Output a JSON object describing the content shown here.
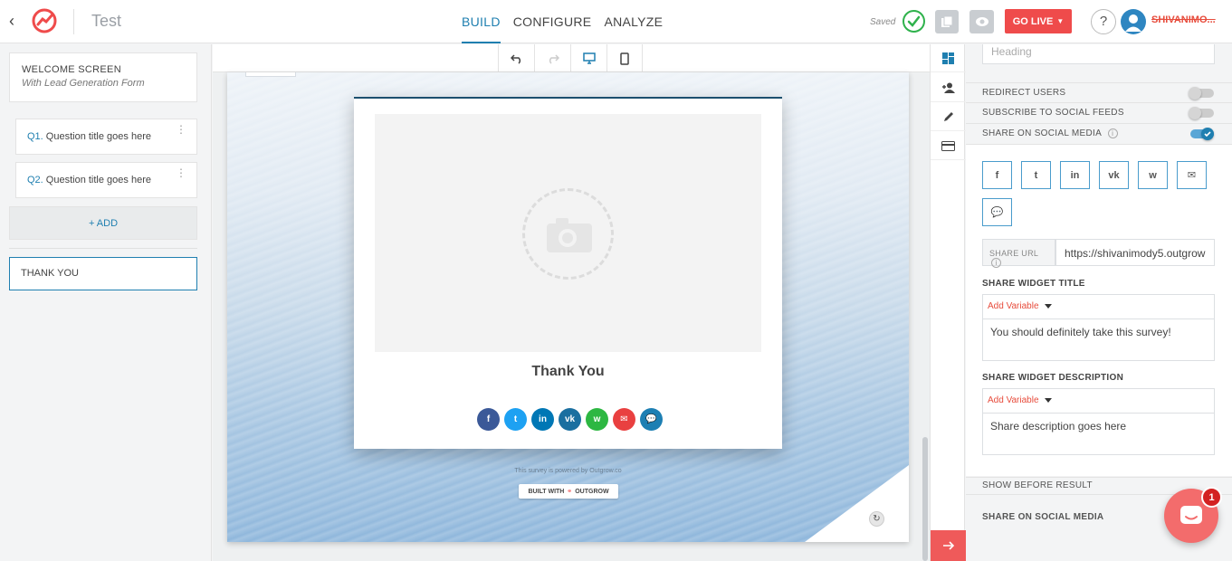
{
  "header": {
    "project_title": "Test",
    "nav": [
      "BUILD",
      "CONFIGURE",
      "ANALYZE"
    ],
    "active_nav": "BUILD",
    "saved_label": "Saved",
    "go_live_label": "GO LIVE",
    "help_label": "?",
    "username": "SHIVANIMO..."
  },
  "left_panel": {
    "welcome_title": "WELCOME SCREEN",
    "welcome_subtitle": "With Lead Generation Form",
    "questions": [
      {
        "num": "Q1.",
        "title": "Question title goes here"
      },
      {
        "num": "Q2.",
        "title": "Question title goes here"
      }
    ],
    "add_label": "+ ADD",
    "thank_you_label": "THANK YOU"
  },
  "preview": {
    "card_title": "Thank You",
    "social_buttons": [
      {
        "icon": "facebook-icon",
        "glyph": "f",
        "color": "#3b5998"
      },
      {
        "icon": "twitter-icon",
        "glyph": "t",
        "color": "#1da1f2"
      },
      {
        "icon": "linkedin-icon",
        "glyph": "in",
        "color": "#0077b5"
      },
      {
        "icon": "vk-icon",
        "glyph": "vk",
        "color": "#1a6fa0"
      },
      {
        "icon": "whatsapp-icon",
        "glyph": "w",
        "color": "#2db742"
      },
      {
        "icon": "email-icon",
        "glyph": "✉",
        "color": "#e94040"
      },
      {
        "icon": "chat-icon",
        "glyph": "💬",
        "color": "#1d7fb3"
      }
    ],
    "powered_text": "This survey is powered by Outgrow.co",
    "built_with_label": "BUILT WITH",
    "built_with_brand": "OUTGROW"
  },
  "right_panel": {
    "heading_placeholder": "Heading",
    "toggles": [
      {
        "label": "REDIRECT USERS",
        "on": false
      },
      {
        "label": "SUBSCRIBE TO SOCIAL FEEDS",
        "on": false
      },
      {
        "label": "SHARE ON SOCIAL MEDIA",
        "on": true
      }
    ],
    "share_icons": [
      {
        "icon": "facebook-icon",
        "glyph": "f"
      },
      {
        "icon": "twitter-icon",
        "glyph": "t"
      },
      {
        "icon": "linkedin-icon",
        "glyph": "in"
      },
      {
        "icon": "vk-icon",
        "glyph": "vk"
      },
      {
        "icon": "whatsapp-icon",
        "glyph": "w"
      },
      {
        "icon": "email-icon",
        "glyph": "✉"
      },
      {
        "icon": "chat-icon",
        "glyph": "💬"
      }
    ],
    "share_url_label": "SHARE URL",
    "share_url_value": "https://shivanimody5.outgrow",
    "widget_title_label": "SHARE WIDGET TITLE",
    "add_variable_label": "Add Variable",
    "widget_title_value": "You should definitely take this survey!",
    "widget_desc_label": "SHARE WIDGET DESCRIPTION",
    "widget_desc_value": "Share description goes here",
    "show_before_result_label": "SHOW BEFORE RESULT",
    "share_on_social_label": "SHARE ON SOCIAL MEDIA"
  },
  "chat": {
    "badge_count": "1"
  },
  "colors": {
    "accent": "#1f7fb0",
    "go_live": "#ef4b4b",
    "saved_green": "#2fb24c"
  }
}
